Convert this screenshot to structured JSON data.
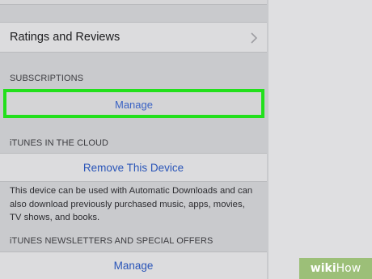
{
  "settings": {
    "ratings_label": "Ratings and Reviews",
    "subscriptions_header": "SUBSCRIPTIONS",
    "subscriptions_manage": "Manage",
    "cloud_header": "iTUNES IN THE CLOUD",
    "remove_device": "Remove This Device",
    "cloud_footnote": "This device can be used with Automatic Downloads and can also download previously purchased music, apps, movies, TV shows, and books.",
    "newsletters_header": "iTUNES NEWSLETTERS AND SPECIAL OFFERS",
    "newsletters_manage": "Manage"
  },
  "watermark": {
    "wiki": "wiki",
    "how": "How"
  },
  "colors": {
    "highlight": "#22e01c",
    "link": "#2a55b8",
    "badge": "#9cbf78"
  },
  "icons": {
    "ratings_chevron": "chevron-right-icon"
  }
}
